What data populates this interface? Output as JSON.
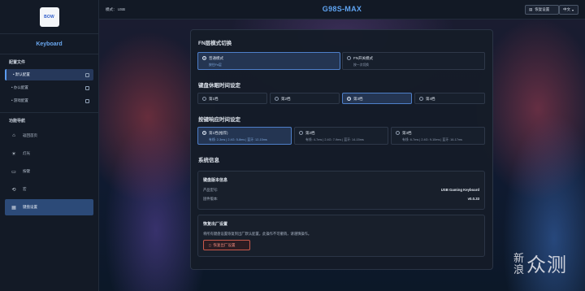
{
  "sidebar": {
    "logo": "BOW",
    "title": "Keyboard",
    "config_header": "配置文件",
    "configs": [
      {
        "label": "默认配置",
        "active": true
      },
      {
        "label": "办公配置",
        "active": false
      },
      {
        "label": "游戏配置",
        "active": false
      }
    ],
    "nav_header": "功能导航",
    "nav": [
      {
        "label": "返回首页",
        "icon": "home-icon",
        "glyph": "⌂",
        "active": false
      },
      {
        "label": "灯光",
        "icon": "sun-icon",
        "glyph": "☀",
        "active": false
      },
      {
        "label": "按键",
        "icon": "keyboard-icon",
        "glyph": "▭",
        "active": false
      },
      {
        "label": "宏",
        "icon": "macro-icon",
        "glyph": "⟲",
        "active": false
      },
      {
        "label": "键盘设置",
        "icon": "grid-icon",
        "glyph": "▦",
        "active": true
      }
    ]
  },
  "topbar": {
    "mode": "模式： USB",
    "device": "G98S-MAX",
    "reset_label": "恢复设置",
    "lang": "中文"
  },
  "fn_mode": {
    "title": "FN层模式切换",
    "options": [
      {
        "label": "普通模式",
        "sub": "按住Fn层",
        "selected": true
      },
      {
        "label": "FN开关模式",
        "sub": "按一次切换",
        "selected": false
      }
    ]
  },
  "sleep": {
    "title": "键盘休眠时间设定",
    "options": [
      {
        "label": "第1档",
        "selected": false
      },
      {
        "label": "第2档",
        "selected": false
      },
      {
        "label": "第3档",
        "selected": true
      },
      {
        "label": "第4档",
        "selected": false
      }
    ]
  },
  "response": {
    "title": "按键响应时间设定",
    "options": [
      {
        "label": "第1档(推荐)",
        "sub": "有线: 2-3ms | 2.4G: 5-8ms | 蓝牙: 12-15ms",
        "selected": true
      },
      {
        "label": "第2档",
        "sub": "有线: 4-7ms | 2.4G: 7-9ms | 蓝牙: 14-15ms",
        "selected": false
      },
      {
        "label": "第3档",
        "sub": "有线: 6-7ms | 2.4G: 9-10ms | 蓝牙: 16-17ms",
        "selected": false
      }
    ]
  },
  "system": {
    "title": "系统信息",
    "version_title": "键盘版本信息",
    "product_label": "产品型号:",
    "product_value": "USB Gaming Keyboard",
    "firmware_label": "固件版本:",
    "firmware_value": "v0.0.33",
    "factory_title": "恢复出厂设置",
    "factory_warning": "将所有键盘设置恢复到出厂默认配置。此操作不可撤销，请谨慎操作。",
    "factory_button": "恢复出厂设置"
  },
  "watermark": {
    "line1": "新",
    "line2": "浪",
    "brand": "众测"
  }
}
